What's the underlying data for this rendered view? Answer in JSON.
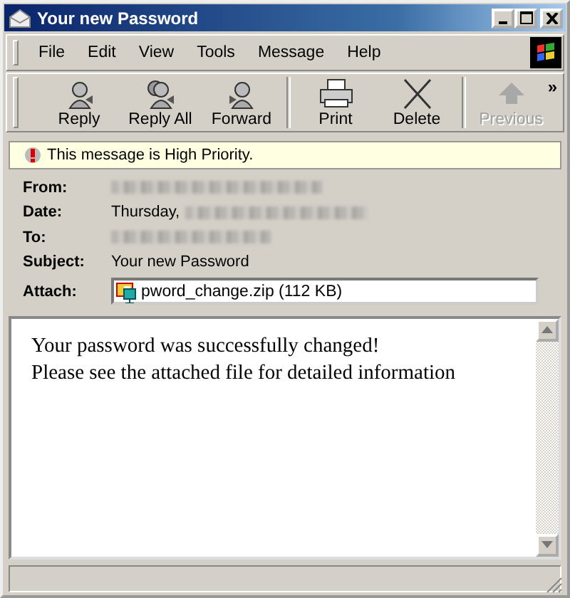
{
  "window": {
    "title": "Your new Password"
  },
  "menu": [
    "File",
    "Edit",
    "View",
    "Tools",
    "Message",
    "Help"
  ],
  "toolbar": [
    {
      "label": "Reply",
      "kind": "reply",
      "disabled": false
    },
    {
      "label": "Reply All",
      "kind": "replyall",
      "disabled": false
    },
    {
      "label": "Forward",
      "kind": "forward",
      "disabled": false
    },
    {
      "label": "Print",
      "kind": "print",
      "disabled": false
    },
    {
      "label": "Delete",
      "kind": "delete",
      "disabled": false
    },
    {
      "label": "Previous",
      "kind": "previous",
      "disabled": true
    }
  ],
  "toolbar_overflow": "»",
  "banner": "This message is High Priority.",
  "headers": [
    {
      "label": "From:",
      "redacted": true
    },
    {
      "label": "Date:",
      "value": "Thursday,",
      "redacted": true
    },
    {
      "label": "To:",
      "redacted": true
    },
    {
      "label": "Subject:",
      "value": "Your new Password",
      "redacted": false
    }
  ],
  "attachment": {
    "label": "Attach:",
    "file": "pword_change.zip (112 KB)"
  },
  "body": [
    "Your password was successfully changed!",
    "Please see the attached file for detailed information"
  ]
}
